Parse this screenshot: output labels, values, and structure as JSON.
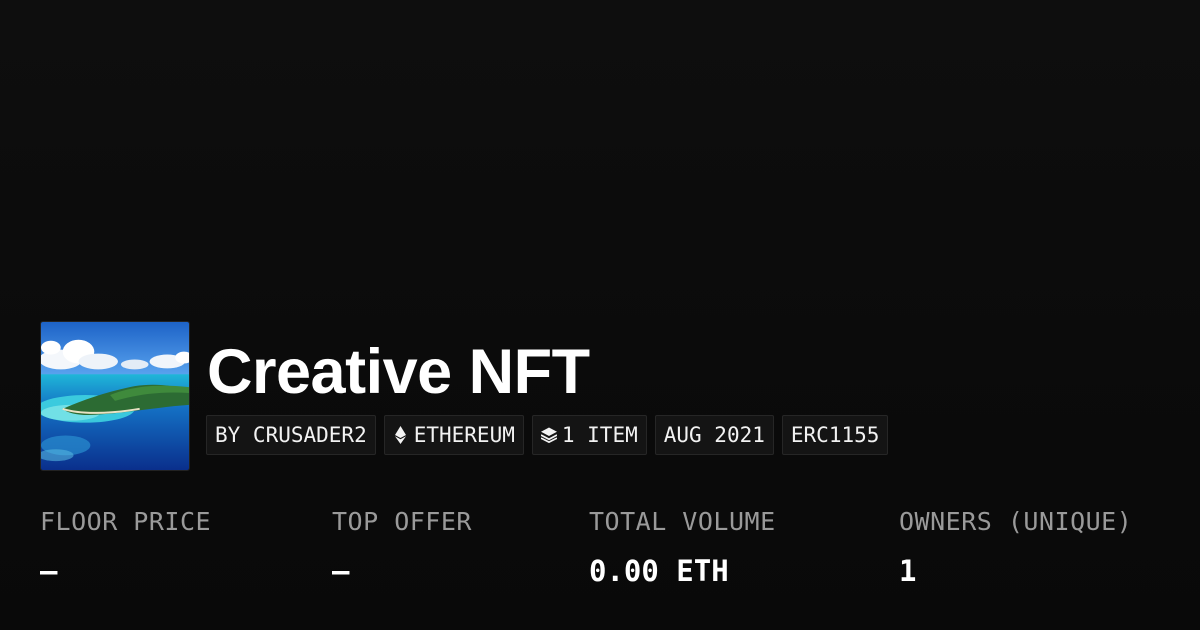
{
  "collection": {
    "title": "Creative NFT",
    "image_icon": "island-lagoon-thumbnail"
  },
  "tags": [
    {
      "label": "BY CRUSADER2",
      "icon": ""
    },
    {
      "label": "ETHEREUM",
      "icon": "ethereum-icon"
    },
    {
      "label": "1 ITEM",
      "icon": "layers-icon"
    },
    {
      "label": "AUG 2021",
      "icon": ""
    },
    {
      "label": "ERC1155",
      "icon": ""
    }
  ],
  "stats": [
    {
      "label": "FLOOR PRICE",
      "value": "—"
    },
    {
      "label": "TOP OFFER",
      "value": "—"
    },
    {
      "label": "TOTAL VOLUME",
      "value": "0.00 ETH"
    },
    {
      "label": "OWNERS (UNIQUE)",
      "value": "1"
    }
  ],
  "colors": {
    "background": "#0b0b0b",
    "tag_background": "#141414",
    "label": "#9a9a9a",
    "text": "#ffffff"
  }
}
